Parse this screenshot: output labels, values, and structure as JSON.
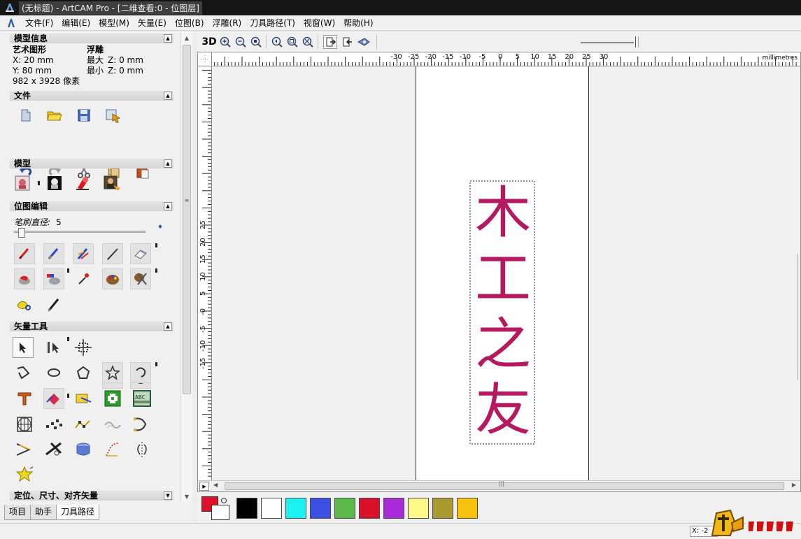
{
  "window": {
    "title": "(无标题) - ArtCAM Pro - [二维查看:0 - 位图层]"
  },
  "menu": [
    {
      "label": "文件(F)"
    },
    {
      "label": "编辑(E)"
    },
    {
      "label": "模型(M)"
    },
    {
      "label": "矢量(E)"
    },
    {
      "label": "位图(B)"
    },
    {
      "label": "浮雕(R)"
    },
    {
      "label": "刀具路径(T)"
    },
    {
      "label": "视窗(W)"
    },
    {
      "label": "帮助(H)"
    }
  ],
  "panel": {
    "model_info": {
      "header": "模型信息",
      "col1_title": "艺术图形",
      "x": "X: 20 mm",
      "y": "Y: 80 mm",
      "pixels": "982 x 3928 像素",
      "col2_title": "浮雕",
      "max_label": "最大",
      "max_z": "Z: 0 mm",
      "min_label": "最小",
      "min_z": "Z: 0 mm"
    },
    "file": {
      "header": "文件",
      "icons": [
        "new-file-icon",
        "open-folder-icon",
        "save-disk-icon",
        "import-icon",
        "undo-icon",
        "redo-icon",
        "cut-scissors-icon",
        "copy-icon",
        "paste-icon"
      ]
    },
    "model": {
      "header": "模型",
      "icons": [
        "model-setup-icon",
        "model-grayscale-icon",
        "model-paint-icon",
        "model-portrait-icon"
      ]
    },
    "bitmap_edit": {
      "header": "位图编辑",
      "brush_label": "笔刷直径:",
      "brush_value": "5",
      "brush_slider_fraction": 0.03,
      "icons": [
        "paint-brush-red-icon",
        "paint-brush-blue-icon",
        "paint-multicolor-icon",
        "draw-pencil-icon",
        "eraser-icon",
        "paint-bucket-red-icon",
        "flood-fill-multicolor-icon",
        "eyedropper-icon",
        "color-palette-icon",
        "palette-scissors-icon",
        "magic-lasso-icon",
        "pen-nib-icon"
      ]
    },
    "vector_tools": {
      "header": "矢量工具",
      "icons": [
        "select-arrow-icon",
        "node-edit-icon",
        "transform-icon",
        "rectangle-icon",
        "circle-icon",
        "polyline-icon",
        "ellipse-icon",
        "polygon-icon",
        "star-icon",
        "arc-icon",
        "text-icon",
        "vector-fill-icon",
        "bitmap-to-vector-icon",
        "add-vector-icon",
        "text-on-curve-icon",
        "vector-grid-icon",
        "vector-nodes-icon",
        "smooth-curve-icon",
        "wave-icon",
        "bezier-icon",
        "offset-vector-icon",
        "trim-vector-icon",
        "extrude-icon",
        "fillet-icon",
        "mirror-icon",
        "star-burst-icon"
      ]
    },
    "next_section": {
      "header": "定位、尺寸、对齐矢量"
    }
  },
  "tabs": [
    {
      "label": "项目"
    },
    {
      "label": "助手"
    },
    {
      "label": "刀具路径",
      "active": true
    }
  ],
  "toolbar": {
    "view3d_label": "3D",
    "icons": [
      "zoom-in-icon",
      "zoom-out-icon",
      "zoom-fit-icon",
      "zoom-previous-icon",
      "zoom-window-icon",
      "zoom-all-icon",
      "show-layer-icon",
      "hide-layer-icon",
      "eye-icon"
    ]
  },
  "rulers": {
    "horizontal_labels": [
      "-30",
      "-25",
      "-20",
      "-15",
      "-10",
      "-5",
      "0",
      "5",
      "10",
      "15",
      "20",
      "25",
      "30"
    ],
    "units": "millimetres",
    "vertical_labels": [
      "25",
      "20",
      "15",
      "10",
      "5",
      "-0",
      "-5",
      "-10",
      "-15"
    ]
  },
  "canvas": {
    "artwork_glyphs": [
      "木",
      "工",
      "之",
      "友"
    ],
    "artwork_color": "#b5195f"
  },
  "palette": {
    "primary": "#e0102a",
    "secondary": "#ffffff",
    "swatches": [
      "#000000",
      "#ffffff",
      "#1cf0f0",
      "#3b4fe0",
      "#5cb84a",
      "#d8102a",
      "#a82ad8",
      "#fcf88a",
      "#a89a2e",
      "#f8c20c"
    ]
  },
  "status": {
    "coord": "X: -2"
  },
  "logo": {
    "text": "木工爱好者"
  }
}
